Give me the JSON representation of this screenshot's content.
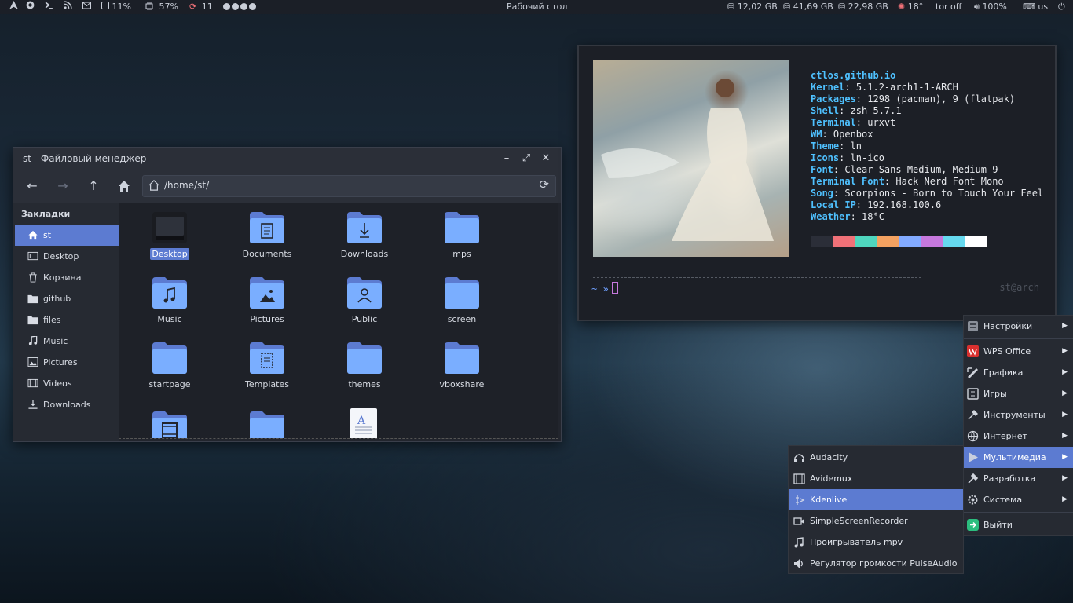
{
  "top_panel": {
    "cpu": "11%",
    "mem": "57%",
    "updates": "11",
    "title": "Рабочий стол",
    "disk1": "12,02 GB",
    "disk2": "41,69 GB",
    "disk3": "22,98 GB",
    "weather": "18°",
    "tor": "tor off",
    "volume": "100%",
    "layout": "us"
  },
  "file_manager": {
    "title": "st - Файловый менеджер",
    "path": "/home/st/",
    "sidebar_header": "Закладки",
    "sidebar": [
      {
        "label": "st",
        "icon": "home-icon"
      },
      {
        "label": "Desktop",
        "icon": "desktop-icon"
      },
      {
        "label": "Корзина",
        "icon": "trash-icon"
      },
      {
        "label": "github",
        "icon": "folder-icon"
      },
      {
        "label": "files",
        "icon": "folder-icon"
      },
      {
        "label": "Music",
        "icon": "music-icon"
      },
      {
        "label": "Pictures",
        "icon": "pictures-icon"
      },
      {
        "label": "Videos",
        "icon": "video-icon"
      },
      {
        "label": "Downloads",
        "icon": "download-icon"
      }
    ],
    "files": [
      {
        "label": "Desktop",
        "icon": "desktop-folder-icon"
      },
      {
        "label": "Documents",
        "icon": "documents-folder-icon"
      },
      {
        "label": "Downloads",
        "icon": "downloads-folder-icon"
      },
      {
        "label": "mps",
        "icon": "folder-icon"
      },
      {
        "label": "Music",
        "icon": "music-folder-icon"
      },
      {
        "label": "Pictures",
        "icon": "pictures-folder-icon"
      },
      {
        "label": "Public",
        "icon": "public-folder-icon"
      },
      {
        "label": "screen",
        "icon": "folder-icon"
      },
      {
        "label": "startpage",
        "icon": "folder-icon"
      },
      {
        "label": "Templates",
        "icon": "templates-folder-icon"
      },
      {
        "label": "themes",
        "icon": "folder-icon"
      },
      {
        "label": "vboxshare",
        "icon": "folder-icon"
      }
    ]
  },
  "terminal": {
    "host": "ctlos.github.io",
    "info": [
      {
        "key": "Kernel",
        "value": "5.1.2-arch1-1-ARCH"
      },
      {
        "key": "Packages",
        "value": "1298 (pacman), 9 (flatpak)"
      },
      {
        "key": "Shell",
        "value": "zsh 5.7.1"
      },
      {
        "key": "Terminal",
        "value": "urxvt"
      },
      {
        "key": "WM",
        "value": "Openbox"
      },
      {
        "key": "Theme",
        "value": "ln"
      },
      {
        "key": "Icons",
        "value": "ln-ico"
      },
      {
        "key": "Font",
        "value": "Clear Sans Medium, Medium 9"
      },
      {
        "key": "Terminal Font",
        "value": "Hack Nerd Font Mono"
      },
      {
        "key": "Song",
        "value": "Scorpions - Born to Touch Your Feel"
      },
      {
        "key": "Local IP",
        "value": "192.168.100.6"
      },
      {
        "key": "Weather",
        "value": "18°C"
      }
    ],
    "palette": [
      "#2b2e38",
      "#f07178",
      "#4fd6be",
      "#f4a261",
      "#82aaff",
      "#c678dd",
      "#66d9ef",
      "#ffffff"
    ],
    "prompt": "~ »",
    "userhost": "st@arch"
  },
  "main_menu": [
    {
      "label": "Настройки",
      "icon": "settings-icon",
      "arrow": "▶"
    },
    {
      "label": "WPS Office",
      "icon": "wps-office-icon",
      "arrow": "▶"
    },
    {
      "label": "Графика",
      "icon": "graphics-icon",
      "arrow": "▶"
    },
    {
      "label": "Игры",
      "icon": "games-icon",
      "arrow": "▶"
    },
    {
      "label": "Инструменты",
      "icon": "tools-icon",
      "arrow": "▶"
    },
    {
      "label": "Интернет",
      "icon": "internet-icon",
      "arrow": "▶"
    },
    {
      "label": "Мультимедиа",
      "icon": "multimedia-icon",
      "arrow": "▶"
    },
    {
      "label": "Разработка",
      "icon": "development-icon",
      "arrow": "▶"
    },
    {
      "label": "Система",
      "icon": "system-icon",
      "arrow": "▶"
    },
    {
      "label": "Выйти",
      "icon": "exit-icon",
      "arrow": ""
    }
  ],
  "multimedia_submenu": [
    {
      "label": "Audacity",
      "icon": "headphones-icon"
    },
    {
      "label": "Avidemux",
      "icon": "film-icon"
    },
    {
      "label": "Kdenlive",
      "icon": "kdenlive-icon"
    },
    {
      "label": "SimpleScreenRecorder",
      "icon": "camera-icon"
    },
    {
      "label": "Проигрыватель mpv",
      "icon": "music-note-icon"
    },
    {
      "label": "Регулятор громкости PulseAudio",
      "icon": "volume-icon"
    }
  ],
  "colors": {
    "accent": "#5c7bd1",
    "folder": "#7aaeff",
    "panel": "#1b1f27"
  }
}
